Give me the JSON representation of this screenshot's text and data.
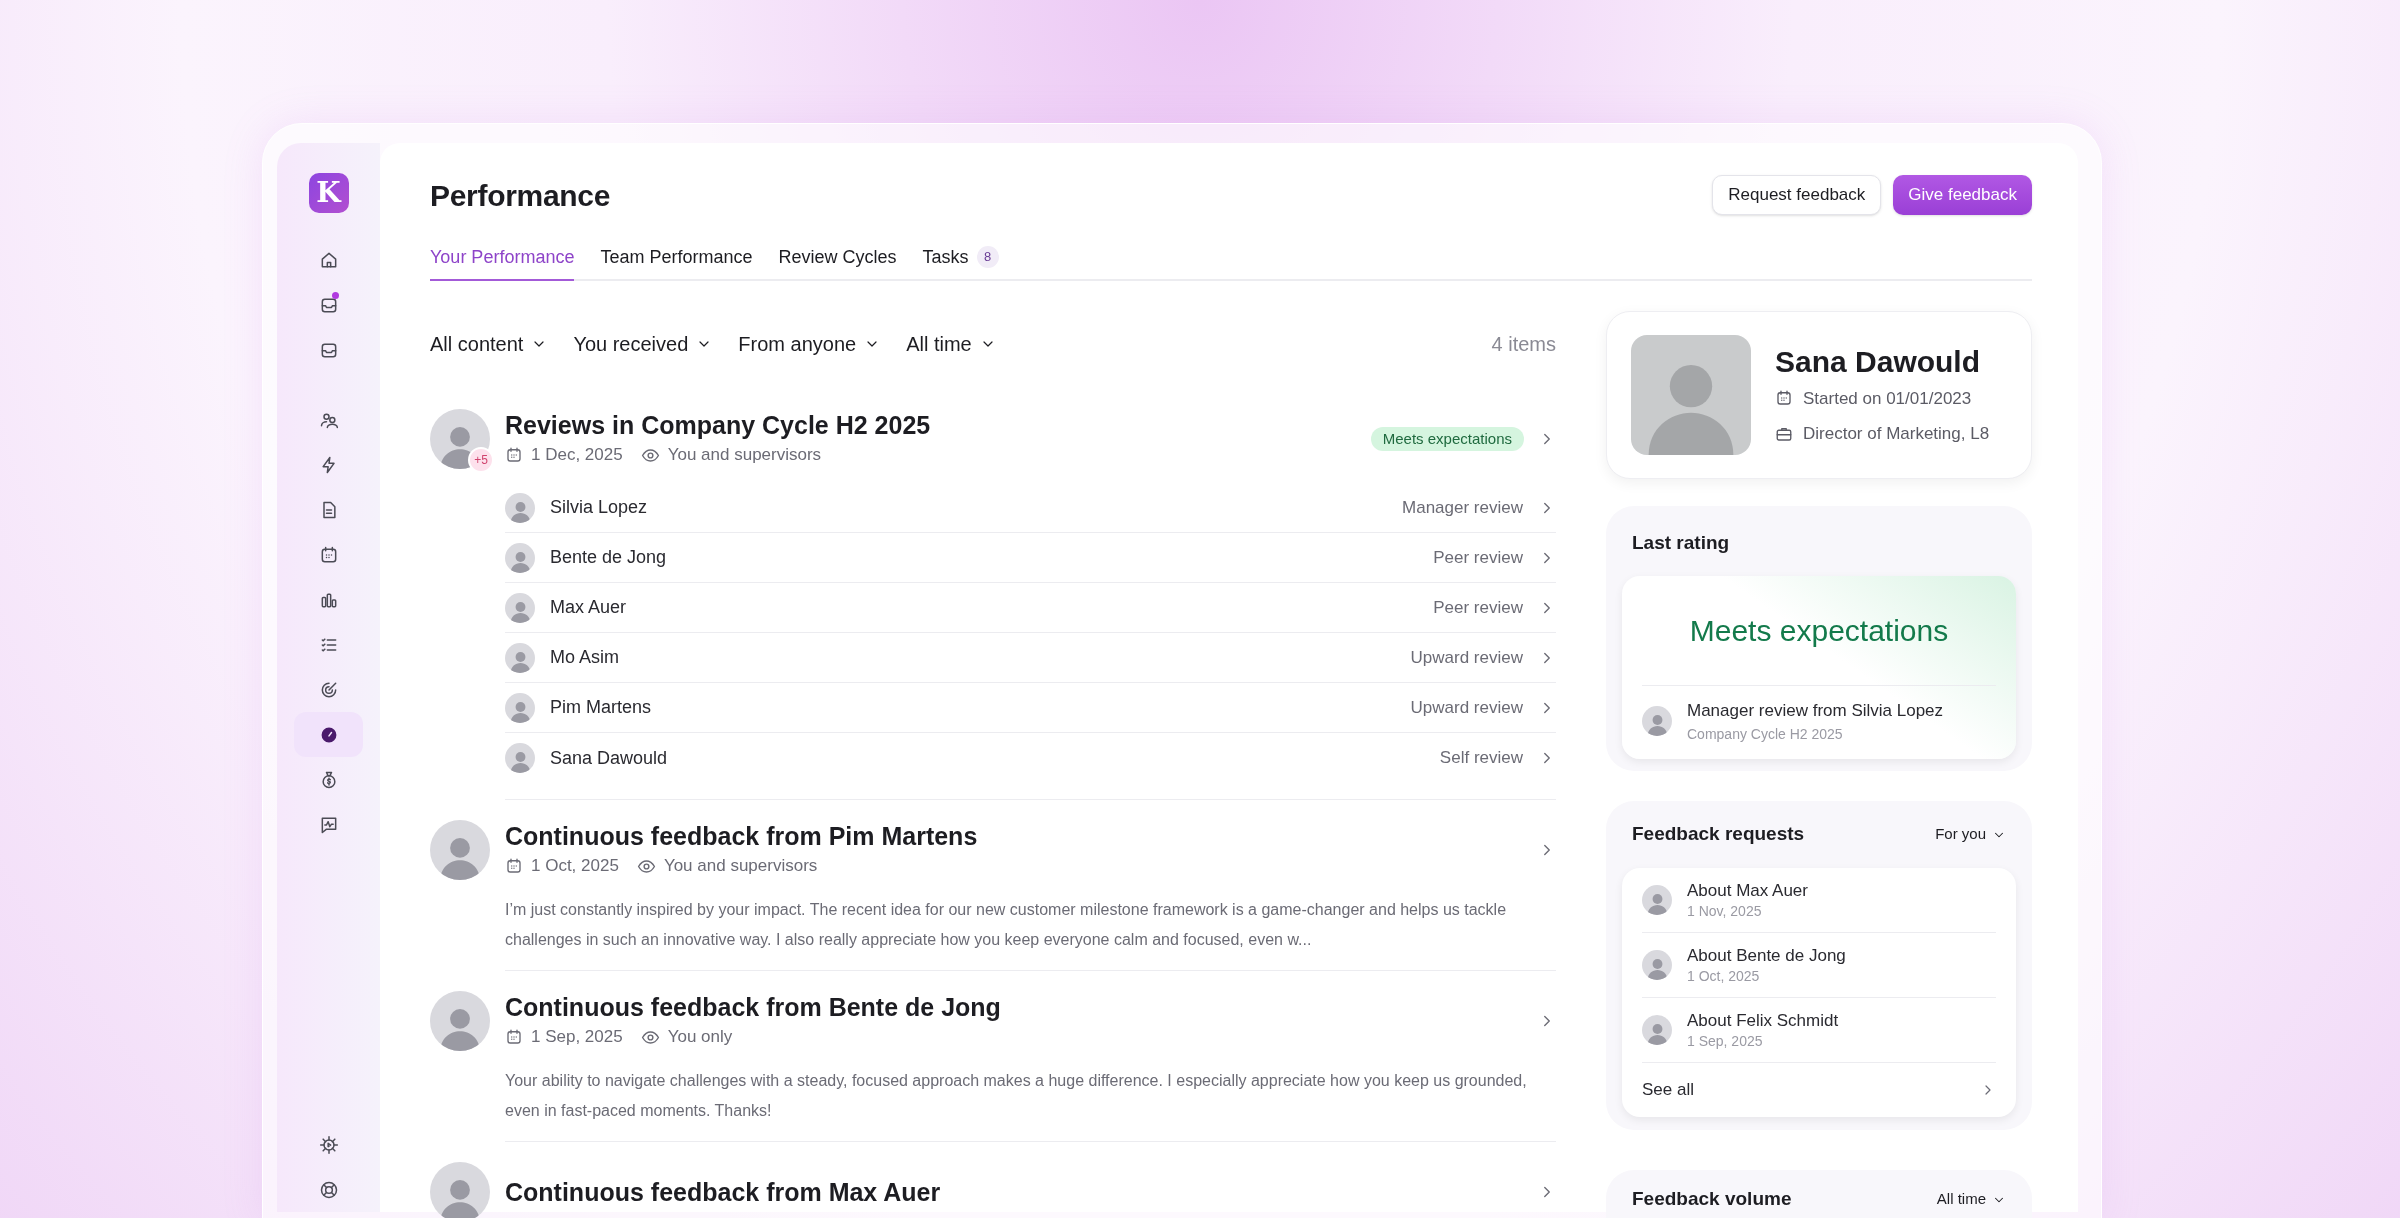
{
  "logo": "K",
  "sidebar": {
    "items": [
      {
        "selected": false,
        "notification": false
      },
      {
        "selected": false,
        "notification": true
      },
      {
        "selected": false,
        "notification": false
      },
      {
        "selected": false,
        "notification": false
      },
      {
        "selected": false,
        "notification": false
      },
      {
        "selected": false,
        "notification": false
      },
      {
        "selected": false,
        "notification": false
      },
      {
        "selected": false,
        "notification": false
      },
      {
        "selected": false,
        "notification": false
      },
      {
        "selected": false,
        "notification": false
      },
      {
        "selected": true,
        "notification": false
      },
      {
        "selected": false,
        "notification": false
      },
      {
        "selected": false,
        "notification": false
      }
    ],
    "bottom_items": [
      {
        "selected": false
      },
      {
        "selected": false
      }
    ]
  },
  "header": {
    "title": "Performance",
    "buttons": [
      {
        "label": "Request feedback",
        "kind": "secondary"
      },
      {
        "label": "Give feedback",
        "kind": "primary"
      }
    ]
  },
  "tabs": [
    {
      "label": "Your Performance",
      "selected": true
    },
    {
      "label": "Team Performance",
      "selected": false
    },
    {
      "label": "Review Cycles",
      "selected": false
    },
    {
      "label": "Tasks",
      "count": "8",
      "selected": false
    }
  ],
  "filters": [
    "All content",
    "You received",
    "From anyone",
    "All time"
  ],
  "item_count": "4 items",
  "feed": [
    {
      "kind": "review_cycle",
      "title": "Reviews in Company Cycle H2 2025",
      "date": "1 Dec, 2025",
      "visibility": "You and supervisors",
      "extra_count": "+5",
      "rating": "Meets expectations",
      "reviews": [
        {
          "name": "Silvia Lopez",
          "type": "Manager review"
        },
        {
          "name": "Bente de Jong",
          "type": "Peer review"
        },
        {
          "name": "Max Auer",
          "type": "Peer review"
        },
        {
          "name": "Mo Asim",
          "type": "Upward review"
        },
        {
          "name": "Pim Martens",
          "type": "Upward review"
        },
        {
          "name": "Sana Dawould",
          "type": "Self review"
        }
      ]
    },
    {
      "kind": "feedback",
      "title": "Continuous feedback from Pim Martens",
      "date": "1 Oct, 2025",
      "visibility": "You and supervisors",
      "text": "I’m just constantly inspired by your impact. The recent idea for our new customer milestone framework is a game-changer and helps us tackle challenges in such an innovative way. I also really appreciate how you keep everyone calm and focused, even w..."
    },
    {
      "kind": "feedback",
      "title": "Continuous feedback from Bente de Jong",
      "date": "1 Sep, 2025",
      "visibility": "You only",
      "text": "Your ability to navigate challenges with a steady, focused approach makes a huge difference. I especially appreciate how you keep us grounded, even in fast-paced moments. Thanks!"
    },
    {
      "kind": "feedback",
      "title": "Continuous feedback from Max Auer"
    }
  ],
  "profile": {
    "name": "Sana Dawould",
    "started": "Started on 01/01/2023",
    "role": "Director of Marketing, L8"
  },
  "last_rating": {
    "title": "Last rating",
    "rating": "Meets expectations",
    "source": "Manager review from Silvia Lopez",
    "cycle": "Company Cycle H2 2025"
  },
  "feedback_requests": {
    "title": "Feedback requests",
    "filter": "For you",
    "items": [
      {
        "title": "About Max Auer",
        "date": "1 Nov, 2025"
      },
      {
        "title": "About Bente de Jong",
        "date": "1 Oct, 2025"
      },
      {
        "title": "About Felix Schmidt",
        "date": "1 Sep, 2025"
      }
    ],
    "see_all": "See all"
  },
  "feedback_volume": {
    "title": "Feedback volume",
    "filter": "All time"
  }
}
